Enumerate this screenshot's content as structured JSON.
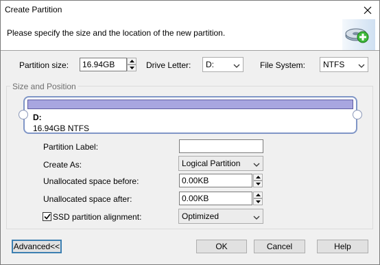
{
  "window": {
    "title": "Create Partition"
  },
  "header": {
    "instruction": "Please specify the size and the location of the new partition."
  },
  "top_row": {
    "partition_size_label": "Partition size:",
    "partition_size_value": "16.94GB",
    "drive_letter_label": "Drive Letter:",
    "drive_letter_value": "D:",
    "file_system_label": "File System:",
    "file_system_value": "NTFS"
  },
  "group": {
    "title": "Size and Position",
    "disk": {
      "name": "D:",
      "info": "16.94GB NTFS"
    },
    "partition_label_label": "Partition Label:",
    "partition_label_value": "",
    "create_as_label": "Create As:",
    "create_as_value": "Logical Partition",
    "unalloc_before_label": "Unallocated space before:",
    "unalloc_before_value": "0.00KB",
    "unalloc_after_label": "Unallocated space after:",
    "unalloc_after_value": "0.00KB",
    "ssd_label": "SSD partition alignment:",
    "ssd_checked": true,
    "ssd_value": "Optimized"
  },
  "buttons": {
    "advanced": "Advanced<<",
    "ok": "OK",
    "cancel": "Cancel",
    "help": "Help"
  },
  "colors": {
    "accent": "#3c7fb1",
    "disk_bar": "#a8a6e0",
    "disk_border": "#7f95c6"
  }
}
